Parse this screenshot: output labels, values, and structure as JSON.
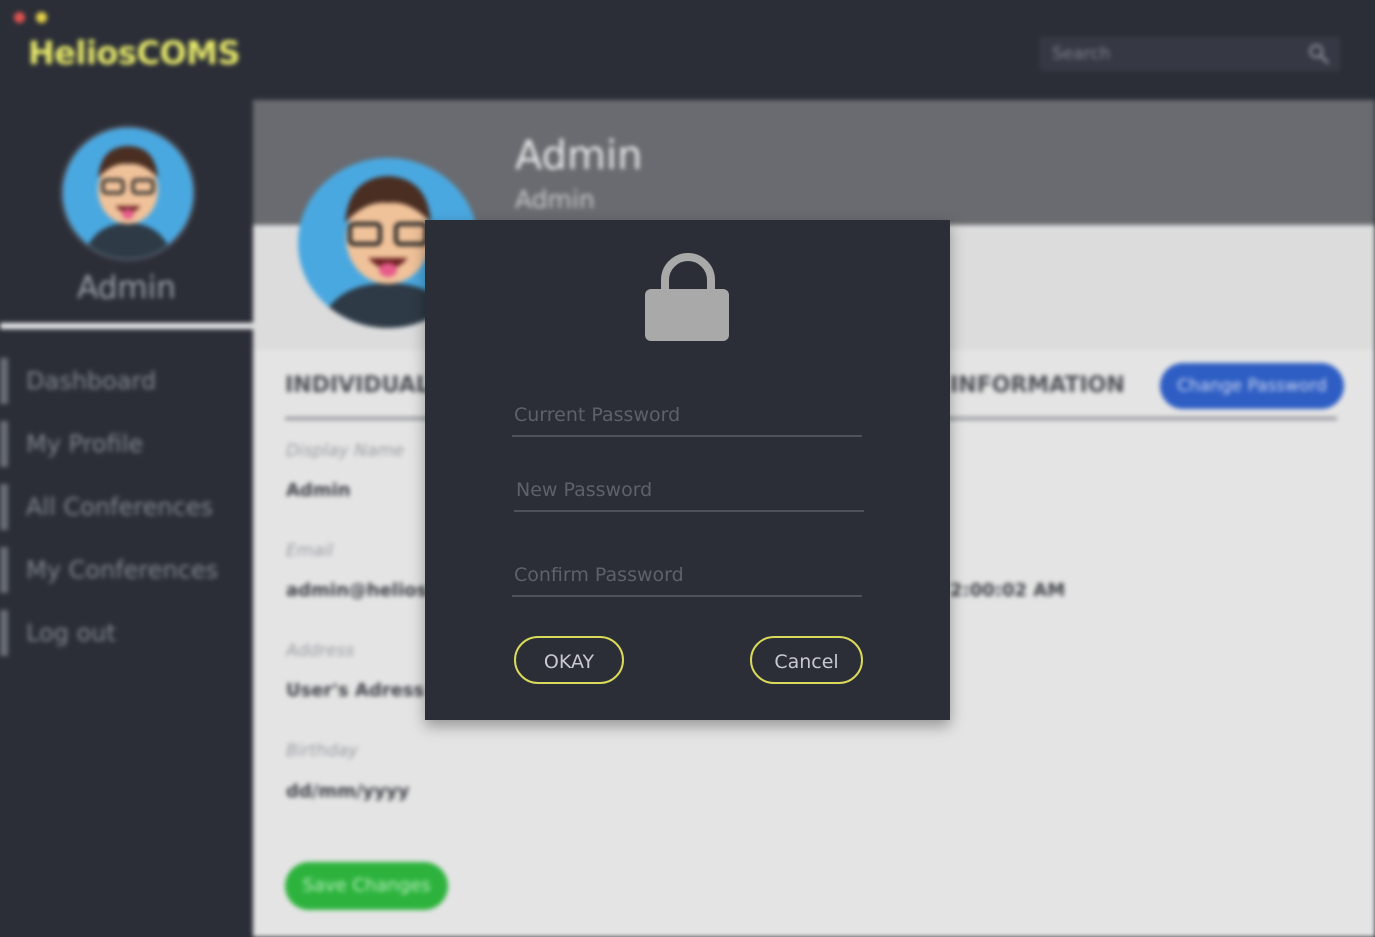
{
  "app": {
    "title": "HeliosCOMS"
  },
  "search": {
    "placeholder": "Search"
  },
  "sidebar": {
    "user_name": "Admin",
    "items": [
      {
        "label": "Dashboard"
      },
      {
        "label": "My Profile"
      },
      {
        "label": "All Conferences"
      },
      {
        "label": "My Conferences"
      },
      {
        "label": "Log out"
      }
    ]
  },
  "profile": {
    "name": "Admin",
    "role": "Admin",
    "section_left": "INDIVIDUAL I",
    "section_right": "INFORMATION",
    "change_password_label": "Change Password",
    "fields": [
      {
        "label": "Display Name",
        "value": "Admin"
      },
      {
        "label": "Email",
        "value": "admin@helios.c"
      },
      {
        "label": "Address",
        "value": "User's Adress"
      },
      {
        "label": "Birthday",
        "value": "dd/mm/yyyy"
      }
    ],
    "time_value": "2:00:02 AM",
    "save_label": "Save Changes"
  },
  "dialog": {
    "current_password_placeholder": "Current Password",
    "new_password_placeholder": "New Password",
    "confirm_password_placeholder": "Confirm Password",
    "ok_label": "OKAY",
    "cancel_label": "Cancel"
  },
  "colors": {
    "background": "#2b2e37",
    "brand": "#e6e86a",
    "button_outline": "#d9d95a",
    "change_password_button": "#2e5ec4",
    "save_button": "#2db33d"
  }
}
